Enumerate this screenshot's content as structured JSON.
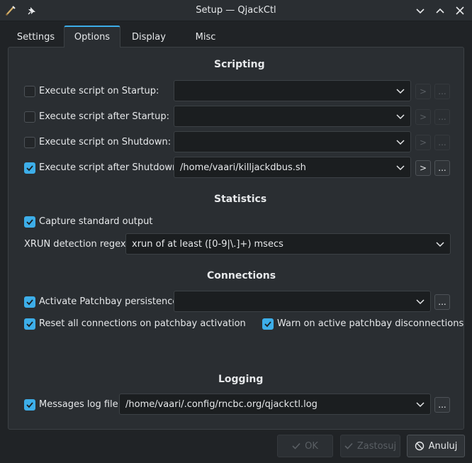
{
  "window": {
    "title": "Setup — QjackCtl"
  },
  "tabs": [
    {
      "label": "Settings"
    },
    {
      "label": "Options"
    },
    {
      "label": "Display"
    },
    {
      "label": "Misc"
    }
  ],
  "scripting": {
    "title": "Scripting",
    "rows": [
      {
        "label": "Execute script on Startup:",
        "checked": false,
        "value": ""
      },
      {
        "label": "Execute script after Startup:",
        "checked": false,
        "value": ""
      },
      {
        "label": "Execute script on Shutdown:",
        "checked": false,
        "value": ""
      },
      {
        "label": "Execute script after Shutdown:",
        "checked": true,
        "value": "/home/vaari/killjackdbus.sh"
      }
    ],
    "symbol_button": ">",
    "browse_button": "..."
  },
  "statistics": {
    "title": "Statistics",
    "capture_label": "Capture standard output",
    "capture_checked": true,
    "xrun_label": "XRUN detection regex:",
    "xrun_value": "xrun of at least ([0-9|\\.]+) msecs"
  },
  "connections": {
    "title": "Connections",
    "patchbay_label": "Activate Patchbay persistence:",
    "patchbay_checked": true,
    "patchbay_value": "",
    "reset_label": "Reset all connections on patchbay activation",
    "reset_checked": true,
    "warn_label": "Warn on active patchbay disconnections",
    "warn_checked": true,
    "browse_button": "..."
  },
  "logging": {
    "title": "Logging",
    "log_label": "Messages log file:",
    "log_checked": true,
    "log_value": "/home/vaari/.config/rncbc.org/qjackctl.log",
    "browse_button": "..."
  },
  "footer": {
    "ok_label": "OK",
    "apply_label": "Zastosuj",
    "cancel_label": "Anuluj"
  },
  "colors": {
    "accent": "#3daee9",
    "background": "#202326",
    "panel": "#2a2e32"
  }
}
